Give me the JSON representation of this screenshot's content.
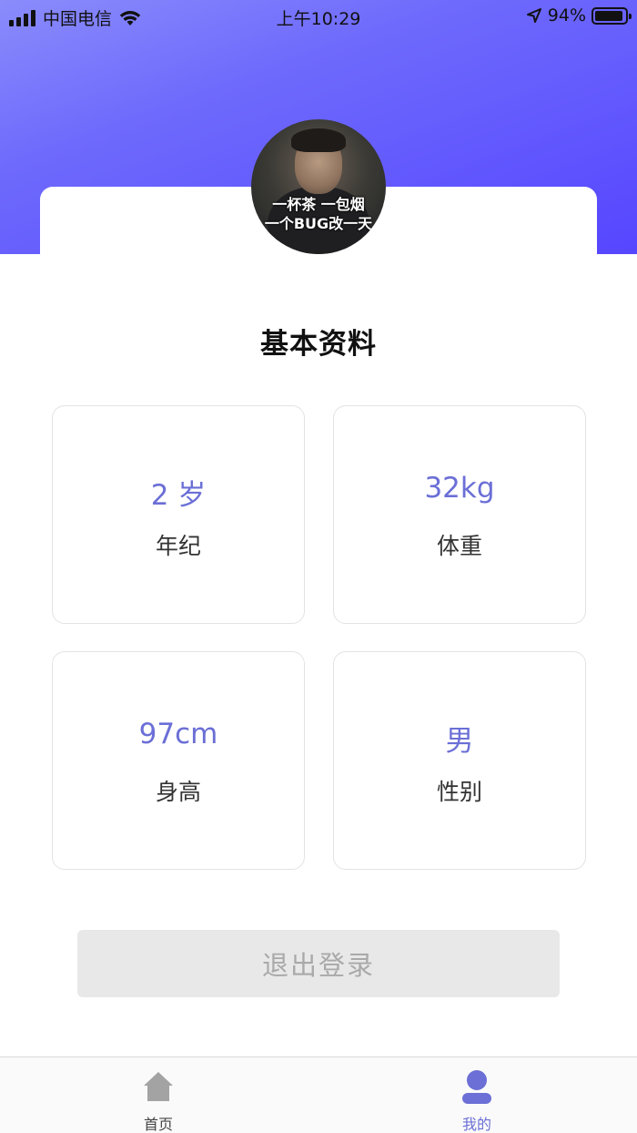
{
  "status_bar": {
    "carrier": "中国电信",
    "time": "上午10:29",
    "battery_percent": "94%",
    "battery_level": 0.94,
    "icons": [
      "signal-icon",
      "wifi-icon",
      "location-arrow-icon",
      "battery-icon"
    ]
  },
  "profile": {
    "avatar_caption_line1": "一杯茶 一包烟",
    "avatar_caption_line2": "一个BUG改一天"
  },
  "section": {
    "title": "基本资料"
  },
  "info": [
    {
      "value": "2 岁",
      "label": "年纪"
    },
    {
      "value": "32kg",
      "label": "体重"
    },
    {
      "value": "97cm",
      "label": "身高"
    },
    {
      "value": "男",
      "label": "性别"
    }
  ],
  "actions": {
    "logout_label": "退出登录"
  },
  "tab_bar": {
    "items": [
      {
        "label": "首页",
        "icon": "home-icon",
        "active": false
      },
      {
        "label": "我的",
        "icon": "user-icon",
        "active": true
      }
    ]
  },
  "colors": {
    "header_gradient_start": "#8a8cfb",
    "header_gradient_end": "#5646ff",
    "accent": "#6b6fd6",
    "button_bg": "#e8e8e8",
    "button_text": "#a9a9a9"
  }
}
